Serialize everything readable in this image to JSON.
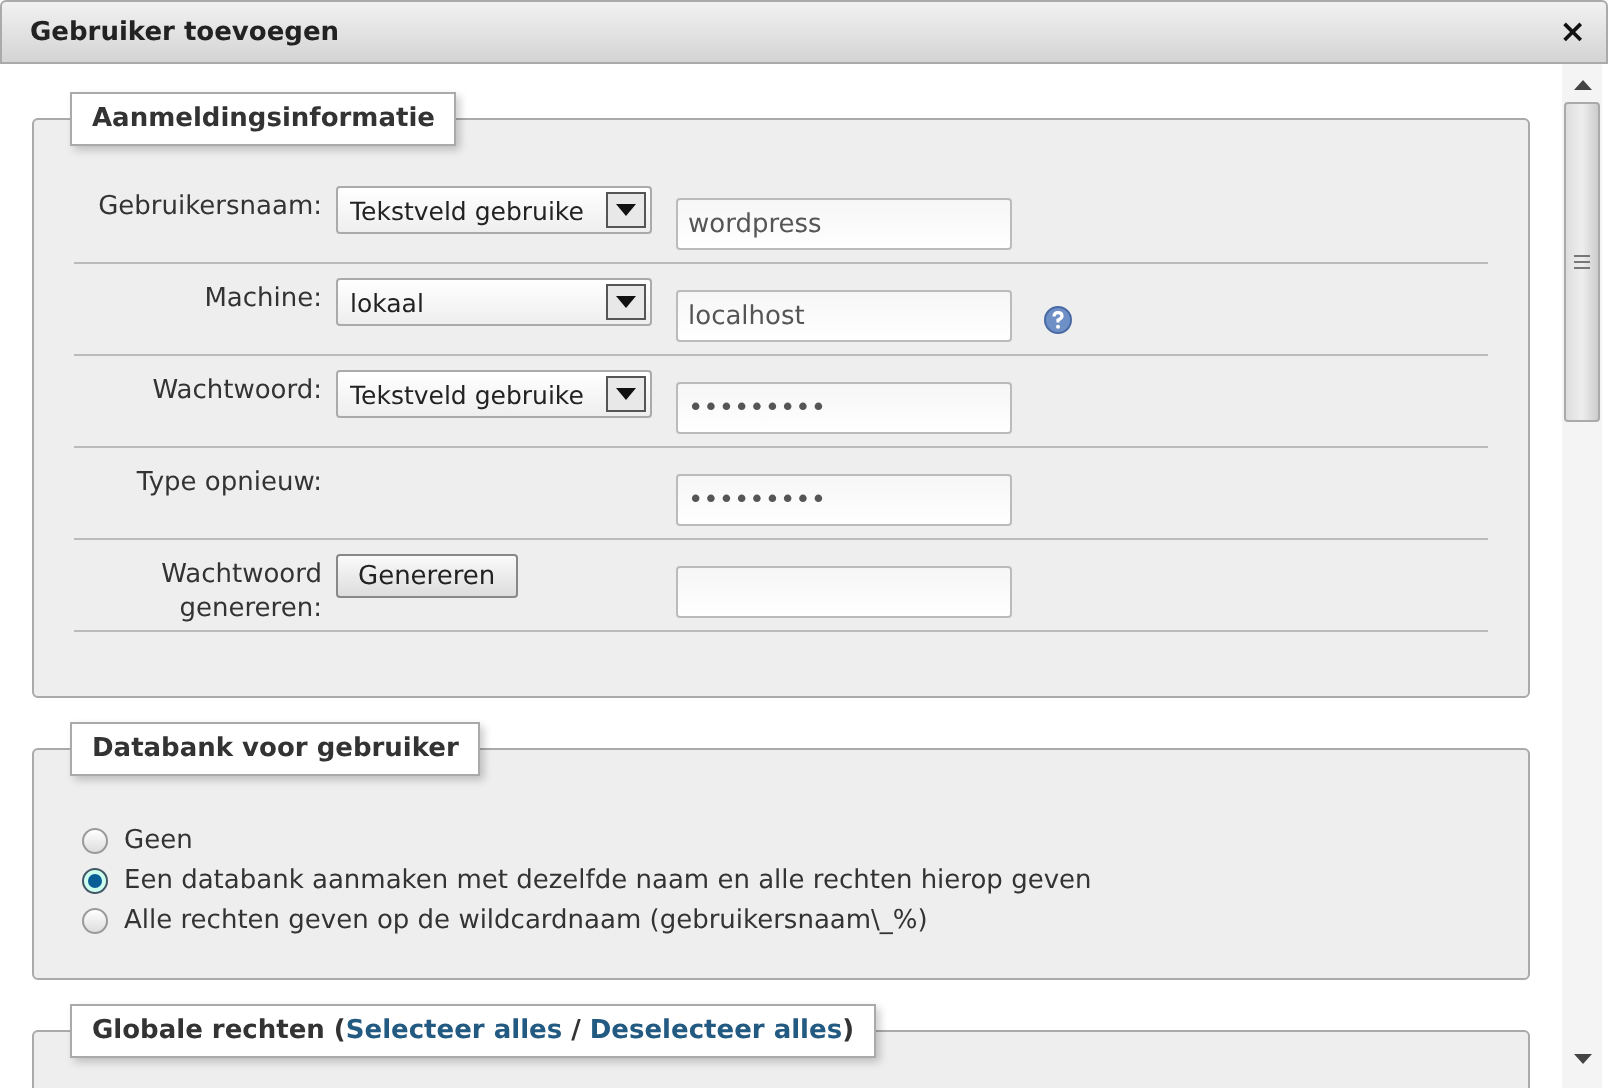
{
  "window": {
    "title": "Gebruiker toevoegen",
    "close": "×"
  },
  "login": {
    "legend": "Aanmeldingsinformatie",
    "rows": [
      {
        "kind": "select",
        "label": "Gebruikersnaam:",
        "select": "Tekstveld gebruike",
        "value": "wordpress",
        "help": false
      },
      {
        "kind": "select",
        "label": "Machine:",
        "select": "lokaal",
        "value": "localhost",
        "help": true
      },
      {
        "kind": "select",
        "label": "Wachtwoord:",
        "select": "Tekstveld gebruike",
        "value": "•••••••••",
        "help": false
      },
      {
        "kind": "plain",
        "label": "Type opnieuw:",
        "value": "•••••••••",
        "help": false
      },
      {
        "kind": "button",
        "label": "Wachtwoord genereren:",
        "button": "Genereren",
        "value": "",
        "help": false
      }
    ]
  },
  "database": {
    "legend": "Databank voor gebruiker",
    "options": [
      {
        "label": "Geen",
        "selected": false
      },
      {
        "label": "Een databank aanmaken met dezelfde naam en alle rechten hierop geven",
        "selected": true
      },
      {
        "label": "Alle rechten geven op de wildcardnaam (gebruikersnaam\\_%)",
        "selected": false
      }
    ]
  },
  "global": {
    "prefix": "Globale rechten (",
    "links": [
      "Selecteer alles",
      "Deselecteer alles"
    ],
    "separator": " / ",
    "suffix": ")"
  }
}
